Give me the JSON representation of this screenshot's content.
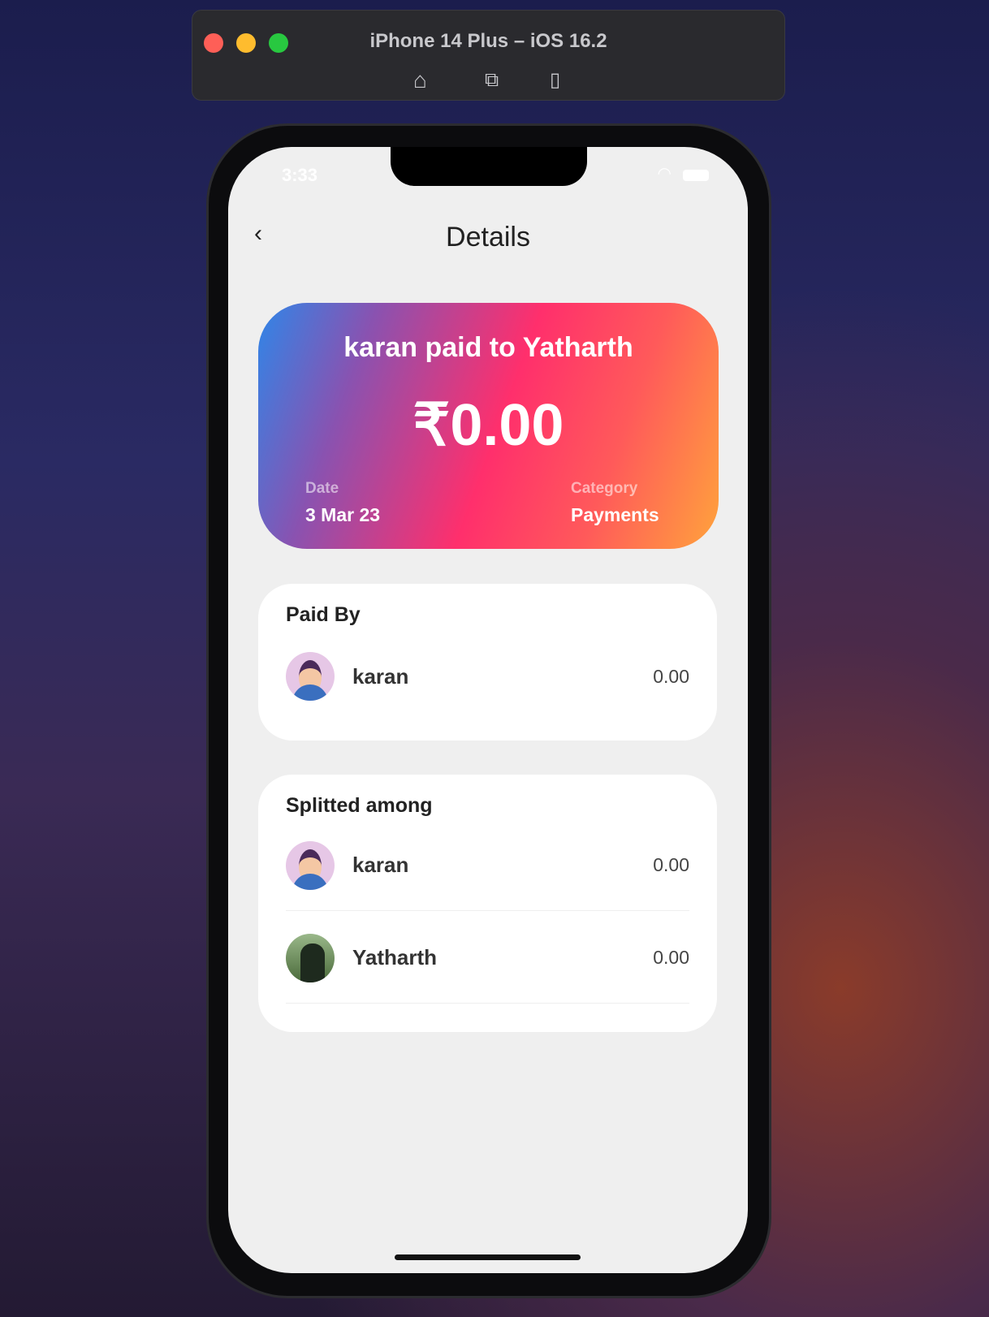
{
  "simulator": {
    "title": "iPhone 14 Plus – iOS 16.2",
    "icons": [
      "home-icon",
      "screenshot-icon",
      "rotate-icon"
    ]
  },
  "status_bar": {
    "time": "3:33"
  },
  "nav": {
    "back_icon": "chevron-left-icon",
    "title": "Details"
  },
  "summary": {
    "heading": "karan paid to Yatharth",
    "amount": "₹0.00",
    "date_label": "Date",
    "date": "3 Mar 23",
    "category_label": "Category",
    "category": "Payments",
    "gradient": [
      "#2f86e8",
      "#ff2f6c",
      "#ffa33c"
    ]
  },
  "paid_by": {
    "title": "Paid By",
    "items": [
      {
        "name": "karan",
        "amount": "0.00"
      }
    ]
  },
  "split": {
    "title": "Splitted among",
    "items": [
      {
        "name": "karan",
        "amount": "0.00"
      },
      {
        "name": "Yatharth",
        "amount": "0.00"
      }
    ]
  }
}
